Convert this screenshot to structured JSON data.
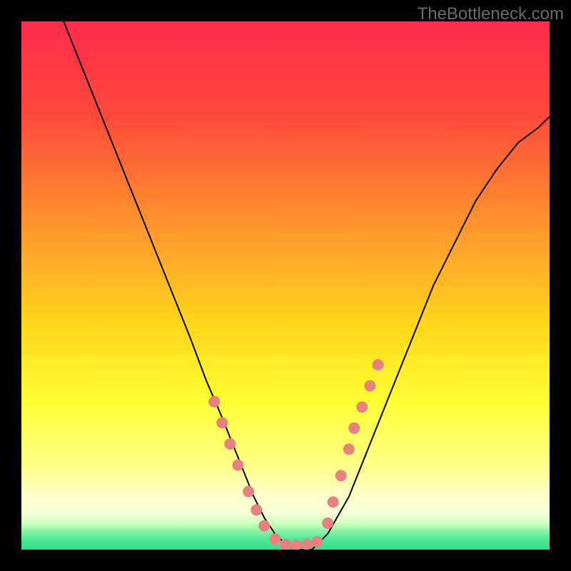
{
  "watermark": "TheBottleneck.com",
  "chart_data": {
    "type": "line",
    "title": "",
    "xlabel": "",
    "ylabel": "",
    "xlim": [
      0,
      100
    ],
    "ylim": [
      0,
      100
    ],
    "background_gradient": {
      "top": "#ff2a4c",
      "mid1": "#ff8a2c",
      "mid2": "#ffe600",
      "mid3": "#ffff66",
      "mid4": "#ffffaa",
      "bottom": "#2fe08a"
    },
    "series": [
      {
        "name": "curve",
        "x": [
          8,
          12,
          16,
          20,
          24,
          28,
          32,
          35,
          38,
          40,
          42,
          44,
          46,
          48,
          50,
          52,
          55,
          58,
          62,
          66,
          70,
          74,
          78,
          82,
          86,
          90,
          94,
          98,
          100
        ],
        "y": [
          100,
          90,
          80,
          70,
          60,
          50,
          40,
          32,
          25,
          20,
          15,
          10,
          6,
          3,
          1,
          0,
          0,
          3,
          10,
          20,
          30,
          40,
          50,
          58,
          66,
          72,
          77,
          80,
          82
        ]
      }
    ],
    "markers": {
      "name": "points",
      "color": "#e88080",
      "x": [
        36.5,
        38,
        39.5,
        41,
        43,
        44.5,
        46,
        48,
        50,
        52,
        54,
        56,
        58,
        59,
        60.5,
        62,
        63,
        64.5,
        66,
        67.5
      ],
      "y": [
        28,
        24,
        20,
        16,
        11,
        7.5,
        4.5,
        2,
        1,
        0.8,
        1,
        1.5,
        5,
        9,
        14,
        19,
        23,
        27,
        31,
        35
      ]
    }
  }
}
